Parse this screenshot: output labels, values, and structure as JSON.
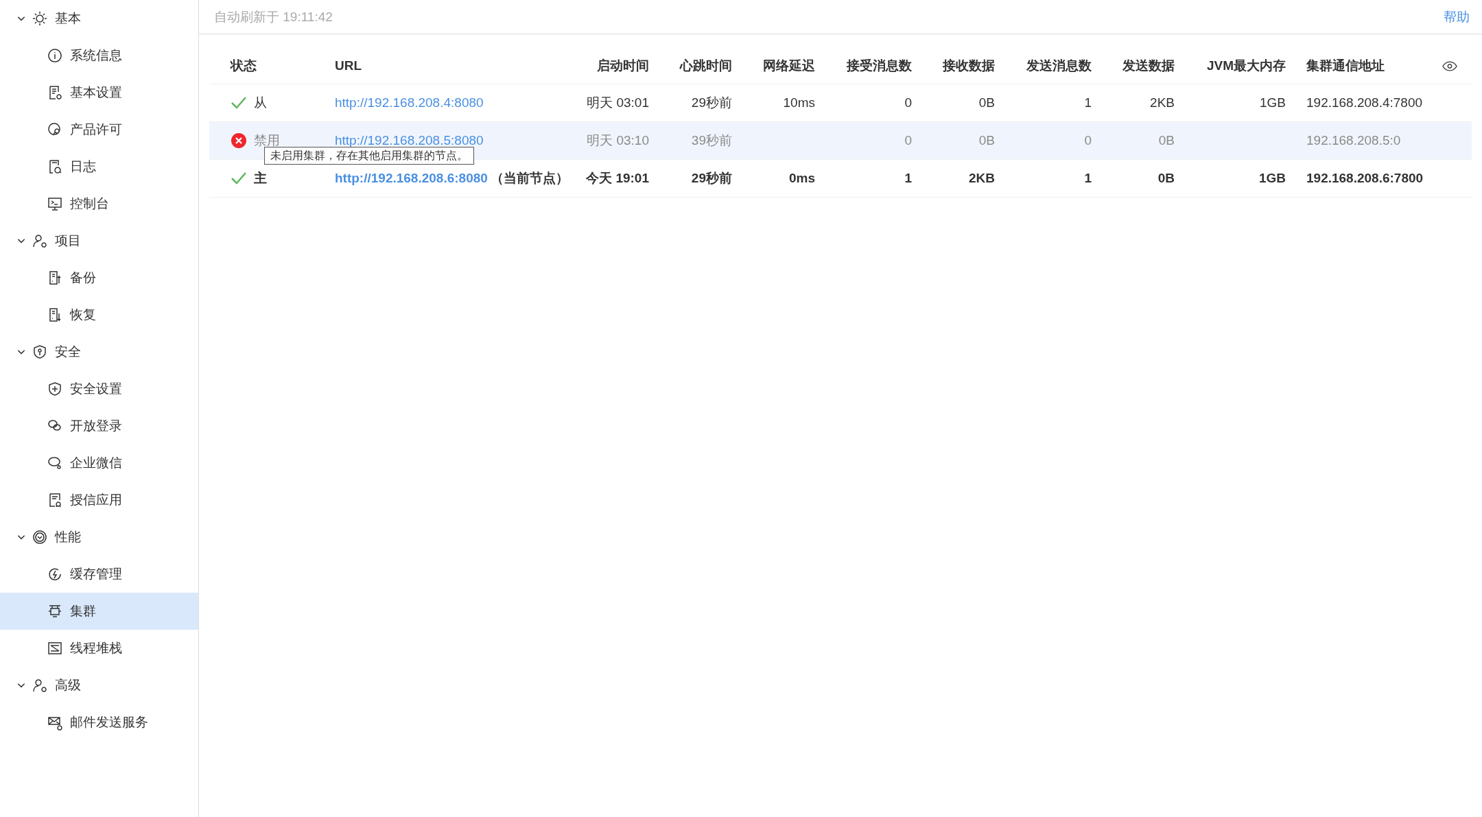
{
  "sidebar": {
    "groups": [
      {
        "label": "基本",
        "expanded": true,
        "children": [
          {
            "label": "系统信息",
            "selected": false
          },
          {
            "label": "基本设置",
            "selected": false
          },
          {
            "label": "产品许可",
            "selected": false
          },
          {
            "label": "日志",
            "selected": false
          },
          {
            "label": "控制台",
            "selected": false
          }
        ]
      },
      {
        "label": "项目",
        "expanded": true,
        "children": [
          {
            "label": "备份",
            "selected": false
          },
          {
            "label": "恢复",
            "selected": false
          }
        ]
      },
      {
        "label": "安全",
        "expanded": true,
        "children": [
          {
            "label": "安全设置",
            "selected": false
          },
          {
            "label": "开放登录",
            "selected": false
          },
          {
            "label": "企业微信",
            "selected": false
          },
          {
            "label": "授信应用",
            "selected": false
          }
        ]
      },
      {
        "label": "性能",
        "expanded": true,
        "children": [
          {
            "label": "缓存管理",
            "selected": false
          },
          {
            "label": "集群",
            "selected": true
          },
          {
            "label": "线程堆栈",
            "selected": false
          }
        ]
      },
      {
        "label": "高级",
        "expanded": true,
        "children": [
          {
            "label": "邮件发送服务",
            "selected": false
          }
        ]
      }
    ]
  },
  "topbar": {
    "refresh_text": "自动刷新于 19:11:42",
    "help_link": "帮助"
  },
  "table": {
    "columns": [
      "状态",
      "URL",
      "启动时间",
      "心跳时间",
      "网络延迟",
      "接受消息数",
      "接收数据",
      "发送消息数",
      "发送数据",
      "JVM最大内存",
      "集群通信地址"
    ],
    "rows": [
      {
        "kind": "ok",
        "disabled": false,
        "current": false,
        "hovered": false,
        "cells": [
          "从",
          "http://192.168.208.4:8080",
          "明天 03:01",
          "29秒前",
          "10ms",
          "0",
          "0B",
          "1",
          "2KB",
          "1GB",
          "192.168.208.4:7800"
        ]
      },
      {
        "kind": "error",
        "disabled": true,
        "current": false,
        "hovered": true,
        "cells": [
          "禁用",
          "http://192.168.208.5:8080",
          "明天 03:10",
          "39秒前",
          "",
          "0",
          "0B",
          "0",
          "0B",
          "",
          "192.168.208.5:0"
        ],
        "tooltip": "未启用集群，存在其他启用集群的节点。"
      },
      {
        "kind": "ok",
        "disabled": false,
        "current": true,
        "hovered": false,
        "url_note": "（当前节点）",
        "cells": [
          "主",
          "http://192.168.208.6:8080",
          "今天 19:01",
          "29秒前",
          "0ms",
          "1",
          "2KB",
          "1",
          "0B",
          "1GB",
          "192.168.208.6:7800"
        ]
      }
    ]
  }
}
